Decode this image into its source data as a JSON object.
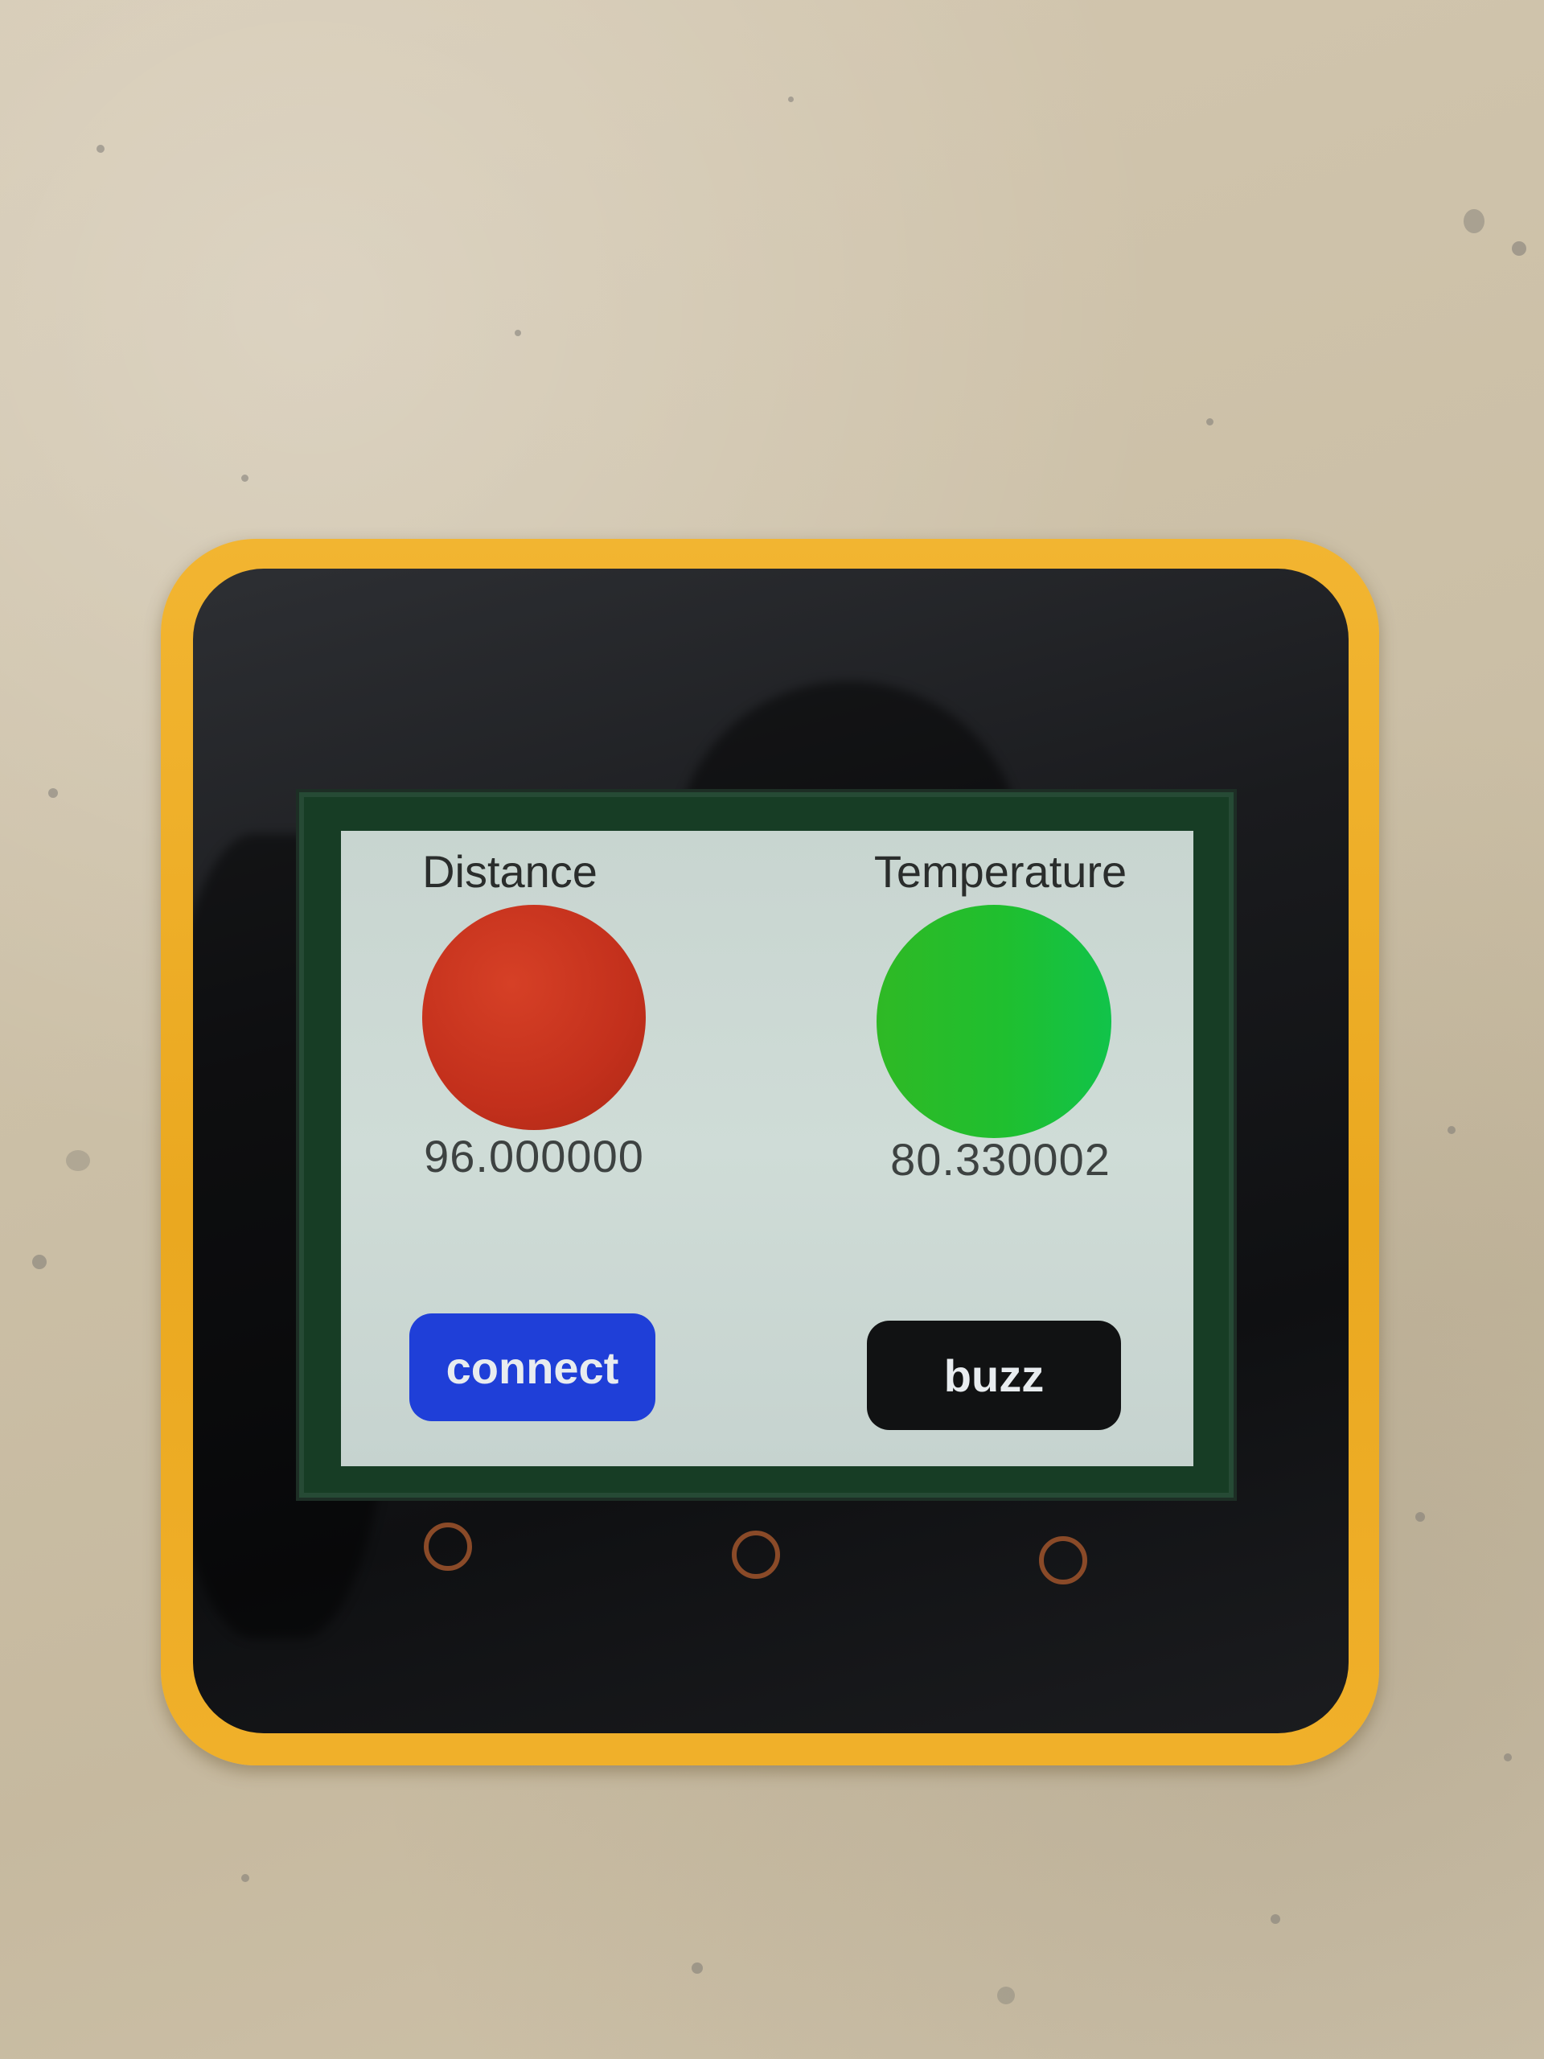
{
  "screen": {
    "distance": {
      "label": "Distance",
      "value": "96.000000",
      "indicator_color": "#c3301c"
    },
    "temperature": {
      "label": "Temperature",
      "value": "80.330002",
      "indicator_color": "#1fbf2f"
    },
    "buttons": {
      "connect_label": "connect",
      "connect_color": "#1f3fd8",
      "buzz_label": "buzz",
      "buzz_color": "#111213"
    }
  },
  "device": {
    "bumper_color": "#efad25",
    "touch_buttons_count": 3
  }
}
